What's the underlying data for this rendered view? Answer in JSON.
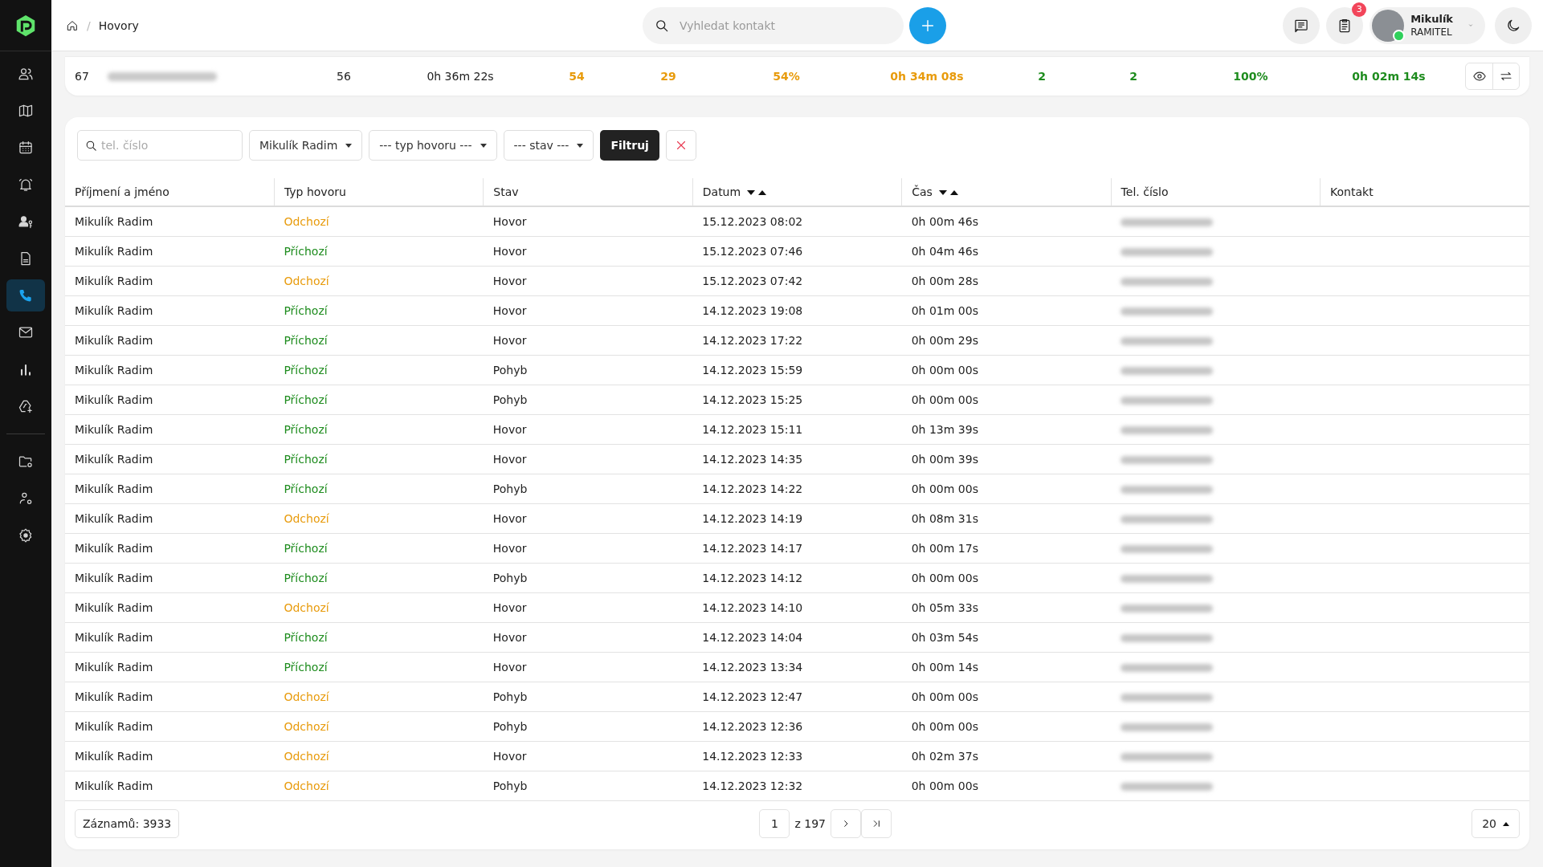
{
  "sidebar": {
    "groups": [
      {
        "items": [
          {
            "selected": false
          },
          {
            "selected": false
          },
          {
            "selected": false
          },
          {
            "selected": false
          },
          {
            "selected": false
          },
          {
            "selected": false
          },
          {
            "selected": true
          },
          {
            "selected": false
          },
          {
            "selected": false
          },
          {
            "selected": false
          }
        ]
      },
      {
        "items": [
          {
            "selected": false
          },
          {
            "selected": false
          },
          {
            "selected": false
          }
        ]
      }
    ]
  },
  "topbar": {
    "breadcrumb_separator": "/",
    "breadcrumb": "Hovory",
    "search": {
      "placeholder": "Vyhledat kontakt"
    },
    "notification_count": "3",
    "user": {
      "name": "Mikulík",
      "company": "RAMITEL",
      "online": true
    }
  },
  "summary_row": {
    "rank": "67",
    "cells": [
      {
        "text": "56",
        "color": "#222222"
      },
      {
        "text": "0h 36m 22s",
        "color": "#222222"
      },
      {
        "text": "54",
        "color": "#e89b0c"
      },
      {
        "text": "29",
        "color": "#e89b0c"
      },
      {
        "text": "54%",
        "color": "#e89b0c"
      },
      {
        "text": "0h 34m 08s",
        "color": "#e89b0c"
      },
      {
        "text": "2",
        "color": "#1e8c1e"
      },
      {
        "text": "2",
        "color": "#1e8c1e"
      },
      {
        "text": "100%",
        "color": "#1e8c1e"
      },
      {
        "text": "0h 02m 14s",
        "color": "#1e8c1e"
      }
    ]
  },
  "filters": {
    "phone": {
      "placeholder": "tel. číslo"
    },
    "selects": [
      "Mikulík Radim",
      "--- typ hovoru ---",
      "--- stav ---"
    ],
    "submit": "Filtruj"
  },
  "table": {
    "columns": [
      {
        "label": "Příjmení a jméno",
        "sortable": false
      },
      {
        "label": "Typ hovoru",
        "sortable": false
      },
      {
        "label": "Stav",
        "sortable": false
      },
      {
        "label": "Datum",
        "sortable": true
      },
      {
        "label": "Čas",
        "sortable": true
      },
      {
        "label": "Tel. číslo",
        "sortable": false
      },
      {
        "label": "Kontakt",
        "sortable": false
      }
    ],
    "rows": [
      {
        "name": "Mikulík Radim",
        "type": "Odchozí",
        "kind": "outgoing",
        "state": "Hovor",
        "date": "15.12.2023 08:02",
        "duration": "0h 00m 46s"
      },
      {
        "name": "Mikulík Radim",
        "type": "Příchozí",
        "kind": "incoming",
        "state": "Hovor",
        "date": "15.12.2023 07:46",
        "duration": "0h 04m 46s"
      },
      {
        "name": "Mikulík Radim",
        "type": "Odchozí",
        "kind": "outgoing",
        "state": "Hovor",
        "date": "15.12.2023 07:42",
        "duration": "0h 00m 28s"
      },
      {
        "name": "Mikulík Radim",
        "type": "Příchozí",
        "kind": "incoming",
        "state": "Hovor",
        "date": "14.12.2023 19:08",
        "duration": "0h 01m 00s"
      },
      {
        "name": "Mikulík Radim",
        "type": "Příchozí",
        "kind": "incoming",
        "state": "Hovor",
        "date": "14.12.2023 17:22",
        "duration": "0h 00m 29s"
      },
      {
        "name": "Mikulík Radim",
        "type": "Příchozí",
        "kind": "incoming",
        "state": "Pohyb",
        "date": "14.12.2023 15:59",
        "duration": "0h 00m 00s"
      },
      {
        "name": "Mikulík Radim",
        "type": "Příchozí",
        "kind": "incoming",
        "state": "Pohyb",
        "date": "14.12.2023 15:25",
        "duration": "0h 00m 00s"
      },
      {
        "name": "Mikulík Radim",
        "type": "Příchozí",
        "kind": "incoming",
        "state": "Hovor",
        "date": "14.12.2023 15:11",
        "duration": "0h 13m 39s"
      },
      {
        "name": "Mikulík Radim",
        "type": "Příchozí",
        "kind": "incoming",
        "state": "Hovor",
        "date": "14.12.2023 14:35",
        "duration": "0h 00m 39s"
      },
      {
        "name": "Mikulík Radim",
        "type": "Příchozí",
        "kind": "incoming",
        "state": "Pohyb",
        "date": "14.12.2023 14:22",
        "duration": "0h 00m 00s"
      },
      {
        "name": "Mikulík Radim",
        "type": "Odchozí",
        "kind": "outgoing",
        "state": "Hovor",
        "date": "14.12.2023 14:19",
        "duration": "0h 08m 31s"
      },
      {
        "name": "Mikulík Radim",
        "type": "Příchozí",
        "kind": "incoming",
        "state": "Hovor",
        "date": "14.12.2023 14:17",
        "duration": "0h 00m 17s"
      },
      {
        "name": "Mikulík Radim",
        "type": "Příchozí",
        "kind": "incoming",
        "state": "Pohyb",
        "date": "14.12.2023 14:12",
        "duration": "0h 00m 00s"
      },
      {
        "name": "Mikulík Radim",
        "type": "Odchozí",
        "kind": "outgoing",
        "state": "Hovor",
        "date": "14.12.2023 14:10",
        "duration": "0h 05m 33s"
      },
      {
        "name": "Mikulík Radim",
        "type": "Příchozí",
        "kind": "incoming",
        "state": "Hovor",
        "date": "14.12.2023 14:04",
        "duration": "0h 03m 54s"
      },
      {
        "name": "Mikulík Radim",
        "type": "Příchozí",
        "kind": "incoming",
        "state": "Hovor",
        "date": "14.12.2023 13:34",
        "duration": "0h 00m 14s"
      },
      {
        "name": "Mikulík Radim",
        "type": "Odchozí",
        "kind": "outgoing",
        "state": "Pohyb",
        "date": "14.12.2023 12:47",
        "duration": "0h 00m 00s"
      },
      {
        "name": "Mikulík Radim",
        "type": "Odchozí",
        "kind": "outgoing",
        "state": "Pohyb",
        "date": "14.12.2023 12:36",
        "duration": "0h 00m 00s"
      },
      {
        "name": "Mikulík Radim",
        "type": "Odchozí",
        "kind": "outgoing",
        "state": "Hovor",
        "date": "14.12.2023 12:33",
        "duration": "0h 02m 37s"
      },
      {
        "name": "Mikulík Radim",
        "type": "Odchozí",
        "kind": "outgoing",
        "state": "Pohyb",
        "date": "14.12.2023 12:32",
        "duration": "0h 00m 00s"
      }
    ]
  },
  "pagination": {
    "records": "Záznamů: 3933",
    "page": "1",
    "of": "z 197",
    "per_page": "20"
  }
}
